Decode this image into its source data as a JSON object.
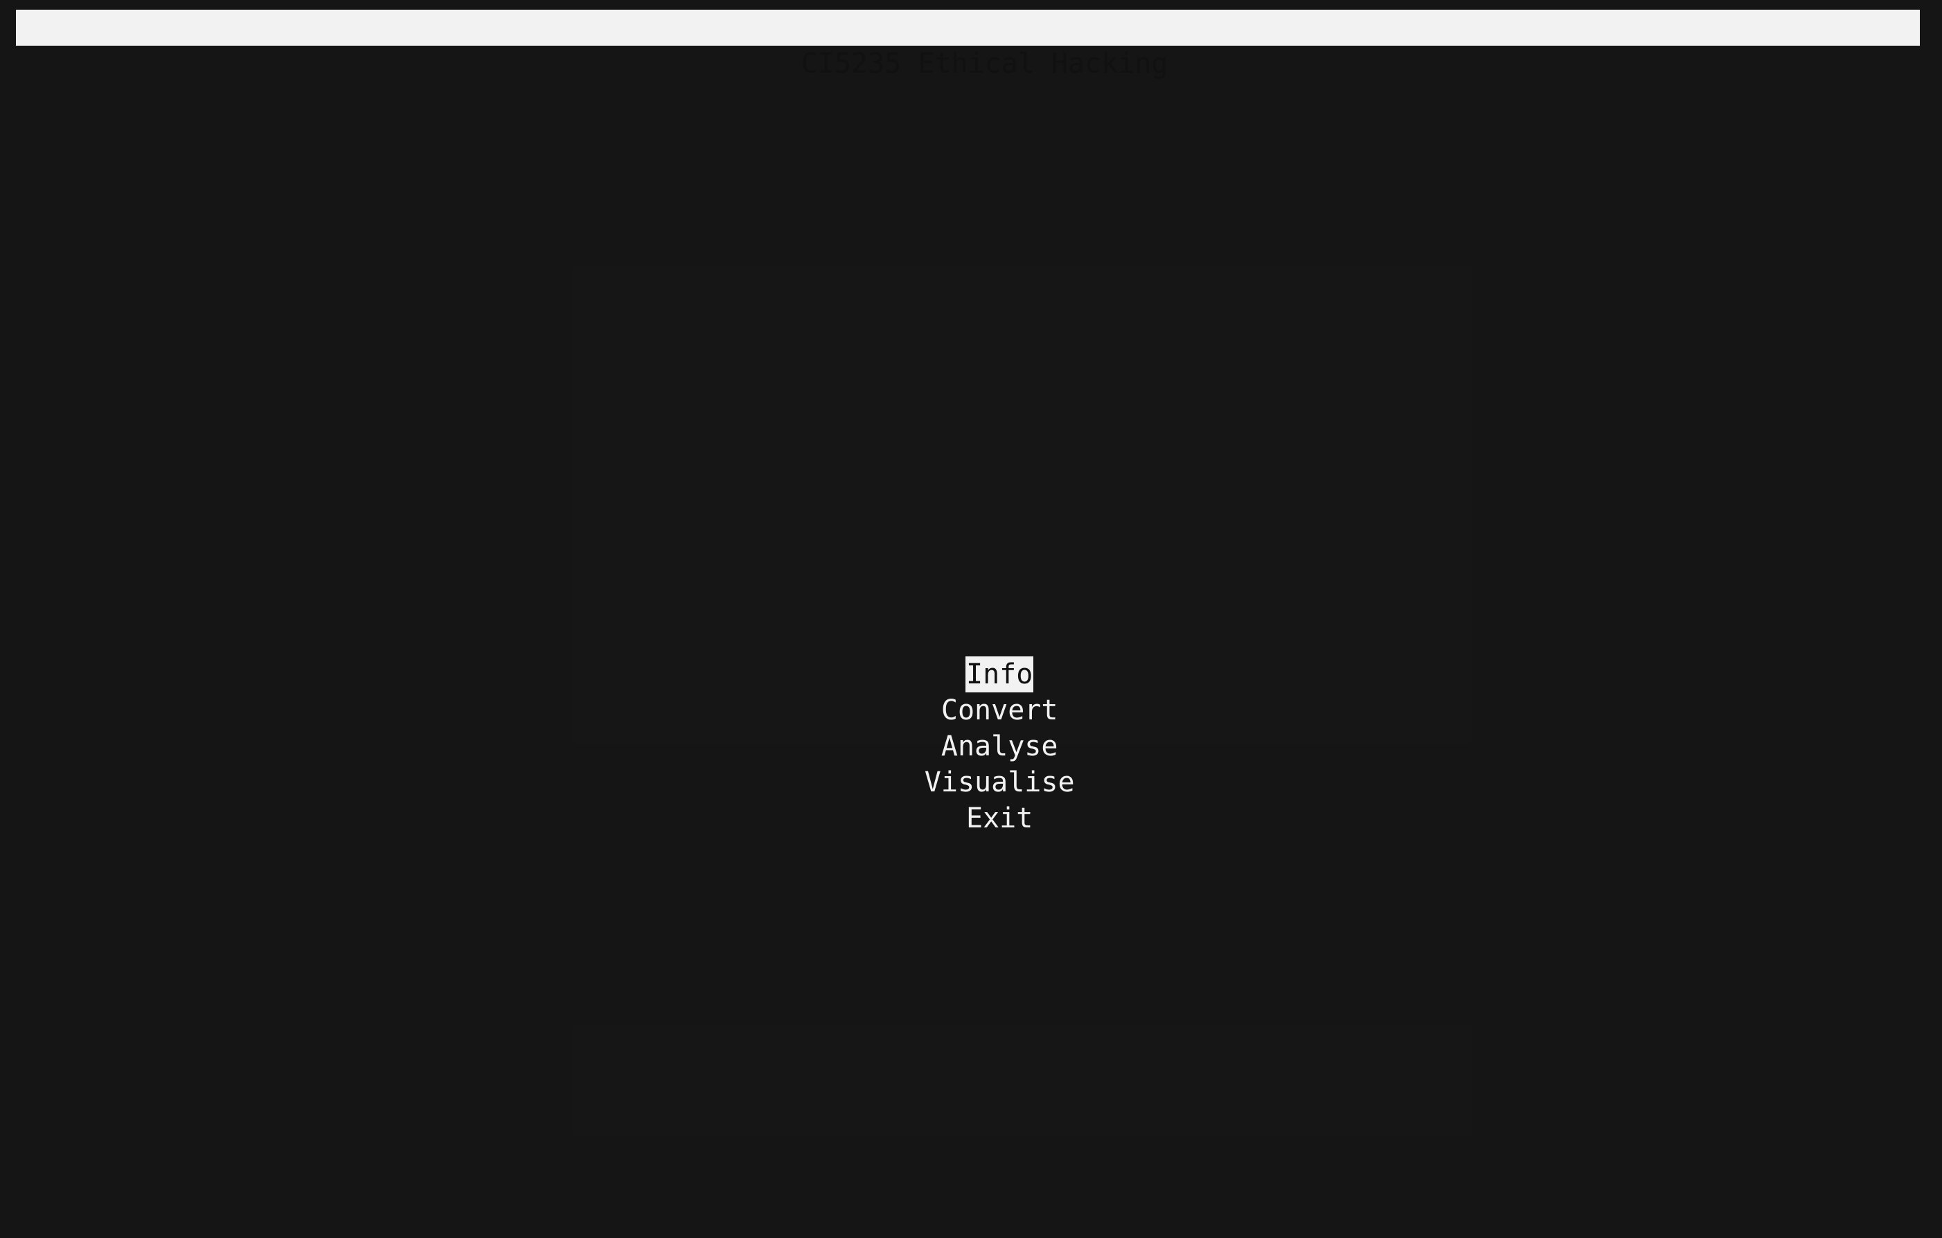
{
  "app": {
    "title": "CI5235 Ethical Hacking"
  },
  "menu": {
    "selected_index": 0,
    "items": [
      {
        "label": "Info"
      },
      {
        "label": "Convert"
      },
      {
        "label": "Analyse"
      },
      {
        "label": "Visualise"
      },
      {
        "label": "Exit"
      }
    ]
  },
  "colors": {
    "background": "#151515",
    "title_bar_bg": "#f2f2f2",
    "title_bar_fg": "#111111",
    "menu_fg": "#f2f2f2",
    "selected_bg": "#f2f2f2",
    "selected_fg": "#111111"
  }
}
